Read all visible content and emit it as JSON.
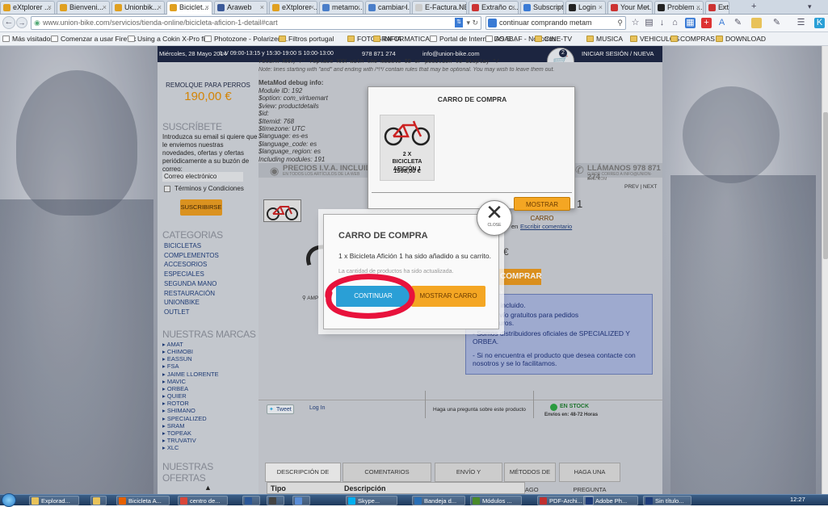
{
  "browser": {
    "tabs": [
      {
        "label": "eXtplorer ...",
        "color": "#e0a020"
      },
      {
        "label": "Bienveni...",
        "color": "#e0a020"
      },
      {
        "label": "Unionbik...",
        "color": "#e0a020"
      },
      {
        "label": "Biciclet...",
        "color": "#e0a020",
        "active": true
      },
      {
        "label": "Araweb",
        "color": "#3b5998"
      },
      {
        "label": "eXtplorer ...",
        "color": "#e0a020"
      },
      {
        "label": "metamo...",
        "color": "#4a7ec9"
      },
      {
        "label": "cambiar l...",
        "color": "#4a7ec9"
      },
      {
        "label": "E-Factura.NET",
        "color": "#cccccc"
      },
      {
        "label": "Extraño c...",
        "color": "#cc3333"
      },
      {
        "label": "Subscript...",
        "color": "#3a7bd5"
      },
      {
        "label": "Login",
        "color": "#222222"
      },
      {
        "label": "Your Met...",
        "color": "#cc3333"
      },
      {
        "label": "Problem ...",
        "color": "#222222"
      },
      {
        "label": "Extr...",
        "color": "#cc3333"
      }
    ],
    "url": "www.union-bike.com/servicios/tienda-online/bicicleta-aficion-1-detail#cart",
    "search": "continuar comprando metam",
    "bookmarks": [
      "Más visitados",
      "Comenzar a usar Firefox",
      "Using a Cokin X-Pro fil...",
      "Photozone - Polarizer ...",
      "Filtros portugal",
      "FOTOGRAFIA",
      "INFORMATICA",
      "Portal de Internet DO S...",
      "ASABAF - Nosotros",
      "CINE-TV",
      "MUSICA",
      "VEHICULOS",
      "COMPRAS",
      "DOWNLOAD"
    ]
  },
  "site": {
    "topbar": {
      "date": "Miércoles, 28 Mayo 2014",
      "hours": "L-V 09:00-13:15 y 15:30-19:00 S 10:00-13:00",
      "phone": "978 871 274",
      "email": "info@union-bike.com",
      "login": "INICIAR SESIÓN / NUEVA CUENTA"
    },
    "sidebar": {
      "product_name": "REMOLQUE PARA PERROS",
      "product_price": "190,00 €",
      "subscribe_title": "SUSCRÍBETE",
      "subscribe_text": "Introduzca su email si quiere que le enviemos nuestras novedades, ofertas y ofertas periódicamente a su buzón de correo:",
      "email_placeholder": "Correo electrónico",
      "terms_label": "Términos y Condiciones",
      "subscribe_button": "SUSCRIBIRSE",
      "categories_title": "CATEGORIAS",
      "categories": [
        "BICICLETAS",
        "COMPLEMENTOS",
        "ACCESORIOS",
        "ESPECIALES",
        "SEGUNDA MANO",
        "RESTAURACIÓN",
        "UNIONBIKE",
        "OUTLET"
      ],
      "brands_title": "NUESTRAS MARCAS",
      "brands": [
        "AMAT",
        "CHIMOBI",
        "EASSUN",
        "FSA",
        "JAIME LLORENTE",
        "MAVIC",
        "ORBEA",
        "QUIER",
        "ROTOR",
        "SHIMANO",
        "SPECIALIZED",
        "SRAM",
        "TOPEAK",
        "TRUVATIV",
        "XLC"
      ],
      "offers_title": "NUESTRAS OFERTAS"
    },
    "debug": {
      "code_line": "return XXX; /* replace XXX with the module ID or position to display */",
      "note": "Note: lines starting with \"and\" and ending with /*!*/ contain rules that may be optional. You may wish to leave them out.",
      "title": "MetaMod debug info:",
      "lines": [
        "Module ID: 192",
        "$option: com_virtuemart",
        "$view: productdetails",
        "$id:",
        "$Itemid: 768",
        "$timezone: UTC",
        "$language: es-es",
        "$language_code: es",
        "$language_region: es",
        "Including modules: 191"
      ]
    },
    "info_strip": {
      "left_title": "PRECIOS I.V.A. INCLUIDO",
      "left_sub": "EN TODOS LOS ARTÍCULOS DE LA WEB",
      "right_title": "LLÁMANOS 978 871 274",
      "right_sub": "O POR CORREO A INFO@UNION-BIKE.COM"
    },
    "pager": "PREV | NEXT",
    "cart_dropdown": {
      "title": "CARRO DE COMPRA",
      "item_qty_name": "2 X BICICLETA AFICIÓN 1",
      "item_price": "1998,00 €",
      "button": "MOSTRAR CARRO",
      "count": "2"
    },
    "product": {
      "qty_digit": "1",
      "comment_link": "Escribir comentario",
      "comment_prefix": "en",
      "euro": "€",
      "buy_button": "COMPRAR",
      "enlarge": "AMP",
      "info_lines": [
        "I.V.A. incluido.",
        "de envío gratuitos para pedidos",
        "les>90 euros.",
        "- Somos distribuidores oficiales de SPECIALIZED Y ORBEA.",
        "- Si no encuentra el producto que desea contacte con nosotros y se lo facilitamos."
      ]
    },
    "social": {
      "tweet": "Tweet",
      "login": "Log In",
      "question": "Haga una pregunta sobre este producto",
      "stock": "EN STOCK",
      "delivery": "Envíos en: 48-72 Horas"
    },
    "product_tabs": [
      "DESCRIPCIÓN DE PRODUCTO",
      "COMENTARIOS",
      "ENVÍO Y DEVOLUCIONES",
      "MÉTODOS DE PAGO",
      "HAGA UNA PREGUNTA"
    ],
    "table_headers": [
      "Tipo",
      "Descripción"
    ]
  },
  "modal": {
    "title": "CARRO DE COMPRA",
    "message": "1 x Bicicleta Afición 1 ha sido añadido a su carrito.",
    "sub_message": "La cantidad de productos ha sido actualizada.",
    "continue_button": "CONTINUAR COMPRANDO",
    "show_cart_button": "MOSTRAR CARRO",
    "close_label": "CLOSE"
  },
  "taskbar": {
    "items": [
      {
        "label": "Explorad...",
        "color": "#e8c25a"
      },
      {
        "label": "",
        "color": "#e8c25a"
      },
      {
        "label": "Bicicleta A...",
        "color": "#e66000"
      },
      {
        "label": "centro de...",
        "color": "#d9473a"
      },
      {
        "label": "",
        "color": "#2b5797"
      },
      {
        "label": "",
        "color": "#444444"
      },
      {
        "label": "",
        "color": "#5a8dd6"
      },
      {
        "label": "Skype...",
        "color": "#00aff0"
      },
      {
        "label": "Bandeja d...",
        "color": "#2a6fb5"
      },
      {
        "label": "Módulos ...",
        "color": "#4a8a2a"
      },
      {
        "label": "PDF-Archi...",
        "color": "#c03030"
      },
      {
        "label": "Adobe Ph...",
        "color": "#1f3d7a"
      },
      {
        "label": "Sin título...",
        "color": "#1f3d7a"
      }
    ],
    "clock": "12:27"
  },
  "colors": {
    "highlight_circle": "#e8123c",
    "blue_button": "#2a9fd6",
    "orange_button": "#f4a623"
  }
}
